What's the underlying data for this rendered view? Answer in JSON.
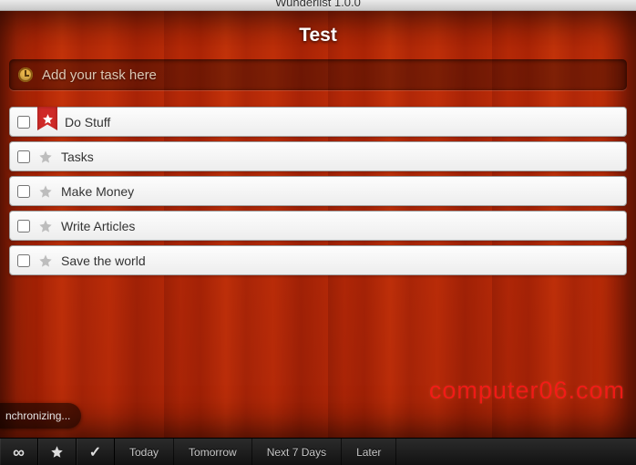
{
  "titlebar": {
    "app_title": "Wunderlist 1.0.0"
  },
  "list": {
    "title": "Test"
  },
  "add_task": {
    "placeholder": "Add your task here"
  },
  "tasks": [
    {
      "title": "Do Stuff",
      "starred": true,
      "done": false
    },
    {
      "title": "Tasks",
      "starred": false,
      "done": false
    },
    {
      "title": "Make Money",
      "starred": false,
      "done": false
    },
    {
      "title": "Write Articles",
      "starred": false,
      "done": false
    },
    {
      "title": "Save the world",
      "starred": false,
      "done": false
    }
  ],
  "status": {
    "sync_text": "nchronizing..."
  },
  "bottombar": {
    "icons": {
      "all": "∞",
      "starred": "★",
      "done": "✓"
    },
    "tabs": [
      "Today",
      "Tomorrow",
      "Next 7 Days",
      "Later"
    ]
  },
  "watermark": "computer06.com"
}
